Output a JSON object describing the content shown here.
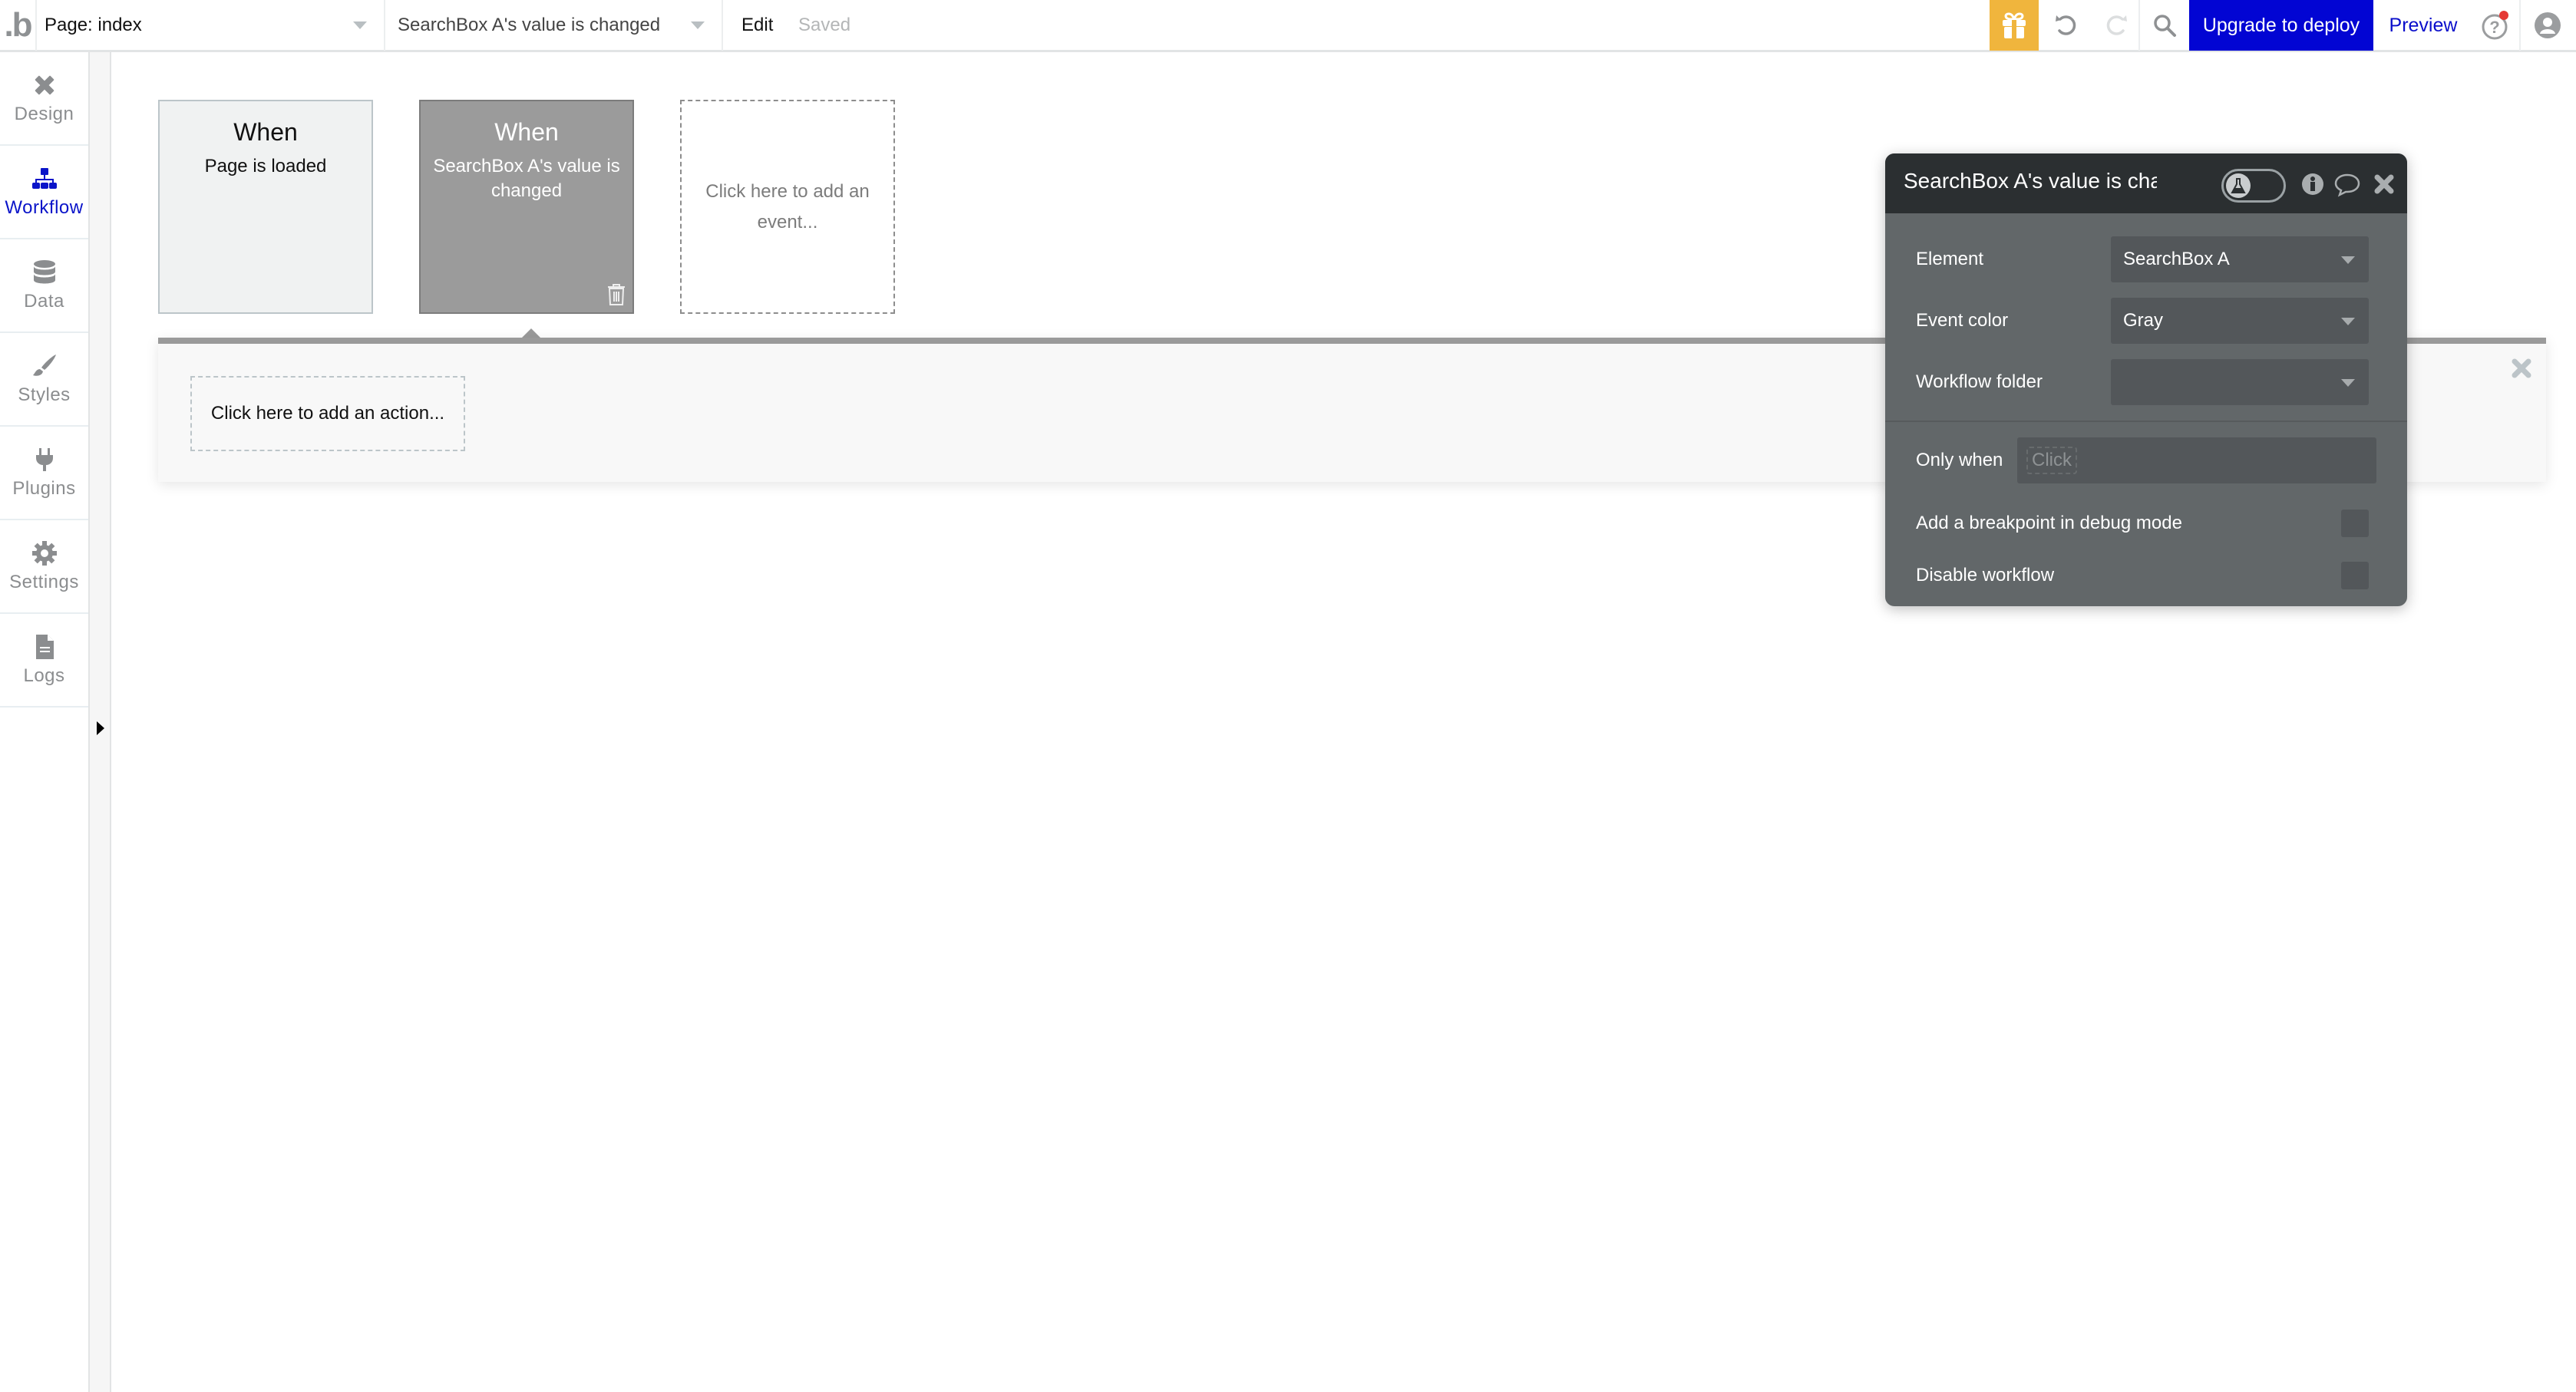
{
  "header": {
    "logo": ".b",
    "page_selector": "Page: index",
    "workflow_selector": "SearchBox A's value is changed",
    "edit_label": "Edit",
    "save_status": "Saved",
    "upgrade_label": "Upgrade to deploy",
    "preview_label": "Preview",
    "colors": {
      "gift": "#f0b53d",
      "upgrade": "#0205d3",
      "preview": "#0a0ecb",
      "notification_dot": "#e53935"
    }
  },
  "sidebar": {
    "active_color": "#0a14c9",
    "items": [
      {
        "label": "Design",
        "icon": "design-icon"
      },
      {
        "label": "Workflow",
        "icon": "workflow-icon",
        "active": true
      },
      {
        "label": "Data",
        "icon": "database-icon"
      },
      {
        "label": "Styles",
        "icon": "brush-icon"
      },
      {
        "label": "Plugins",
        "icon": "plug-icon"
      },
      {
        "label": "Settings",
        "icon": "gear-icon"
      },
      {
        "label": "Logs",
        "icon": "document-icon"
      }
    ]
  },
  "events": [
    {
      "when": "When",
      "description": "Page is loaded"
    },
    {
      "when": "When",
      "description": "SearchBox A's value is changed",
      "selected": true,
      "color": "Gray"
    },
    {
      "add_label": "Click here to add an event..."
    }
  ],
  "actions": {
    "add_label": "Click here to add an action..."
  },
  "panel": {
    "title": "SearchBox A's value is changed",
    "fields": [
      {
        "label": "Element",
        "value": "SearchBox A"
      },
      {
        "label": "Event color",
        "value": "Gray"
      },
      {
        "label": "Workflow folder",
        "value": ""
      }
    ],
    "only_when": {
      "label": "Only when",
      "placeholder": "Click"
    },
    "checkboxes": [
      {
        "label": "Add a breakpoint in debug mode",
        "checked": false
      },
      {
        "label": "Disable workflow",
        "checked": false
      }
    ]
  }
}
